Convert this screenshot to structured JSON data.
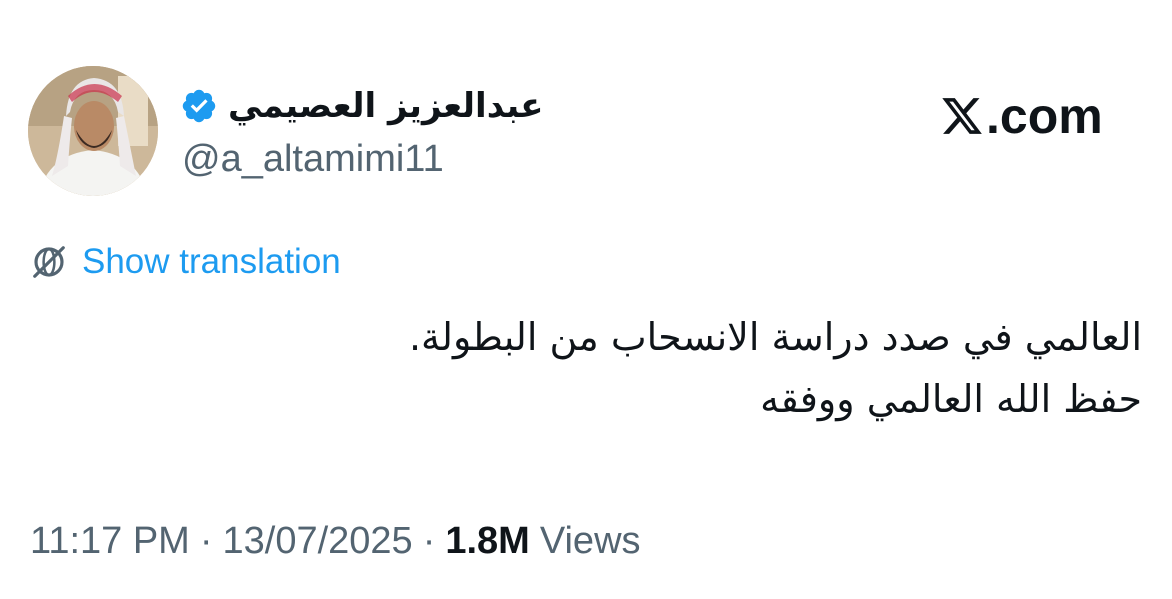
{
  "site": {
    "logo_suffix": ".com",
    "logo_icon": "x-logo-icon"
  },
  "author": {
    "display_name": "عبدالعزيز العصيمي",
    "handle": "@a_altamimi11",
    "verified": true,
    "verified_color": "#1d9bf0",
    "avatar_icon": "profile-photo"
  },
  "translation": {
    "label": "Show translation",
    "icon": "globe-icon",
    "color": "#1d9bf0"
  },
  "tweet": {
    "lines": [
      "العالمي في صدد دراسة الانسحاب من البطولة.",
      "حفظ الله العالمي ووفقه"
    ]
  },
  "meta": {
    "time": "11:17 PM",
    "separator": "·",
    "date": "13/07/2025",
    "views_count": "1.8M",
    "views_label": "Views"
  }
}
